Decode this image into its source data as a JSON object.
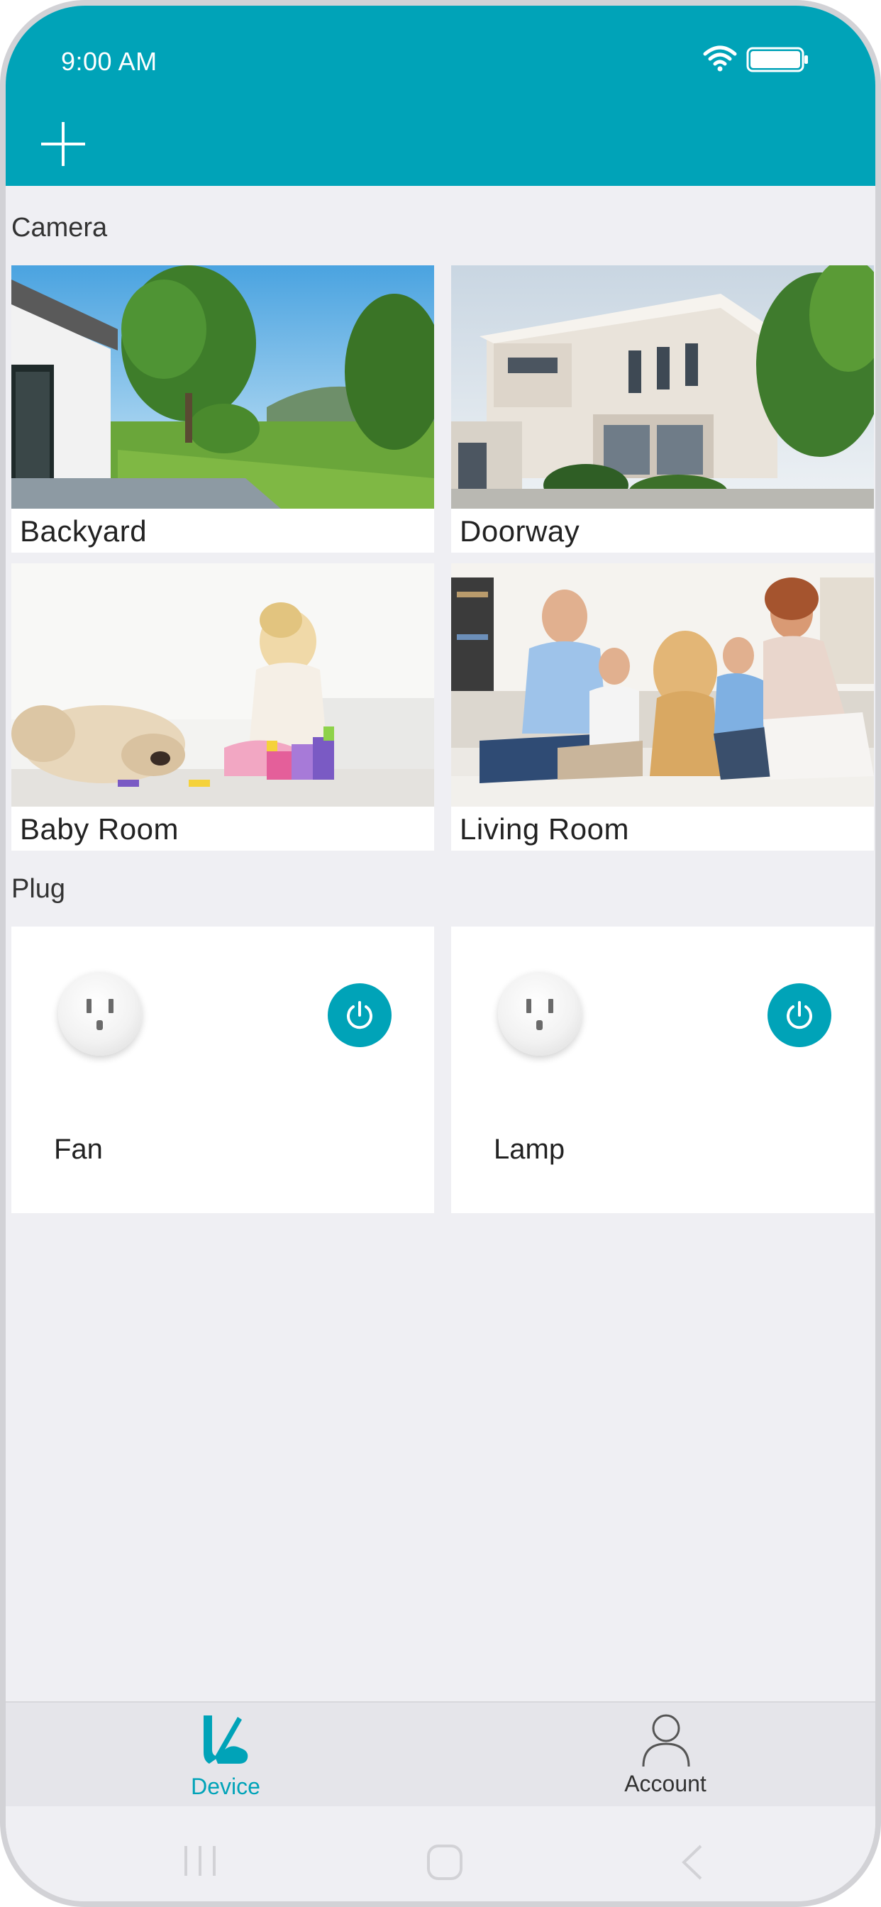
{
  "status_bar": {
    "time": "9:00 AM"
  },
  "sections": {
    "camera": "Camera",
    "plug": "Plug"
  },
  "cameras": [
    {
      "name": "Backyard"
    },
    {
      "name": "Doorway"
    },
    {
      "name": "Baby Room"
    },
    {
      "name": "Living Room"
    }
  ],
  "plugs": [
    {
      "name": "Fan"
    },
    {
      "name": "Lamp"
    }
  ],
  "tabs": {
    "device": "Device",
    "account": "Account"
  },
  "colors": {
    "accent": "#00a3b8",
    "background": "#efeff3"
  },
  "icons": [
    "wifi-icon",
    "battery-icon",
    "add-icon",
    "socket-icon",
    "power-icon",
    "device-logo-icon",
    "account-icon"
  ]
}
